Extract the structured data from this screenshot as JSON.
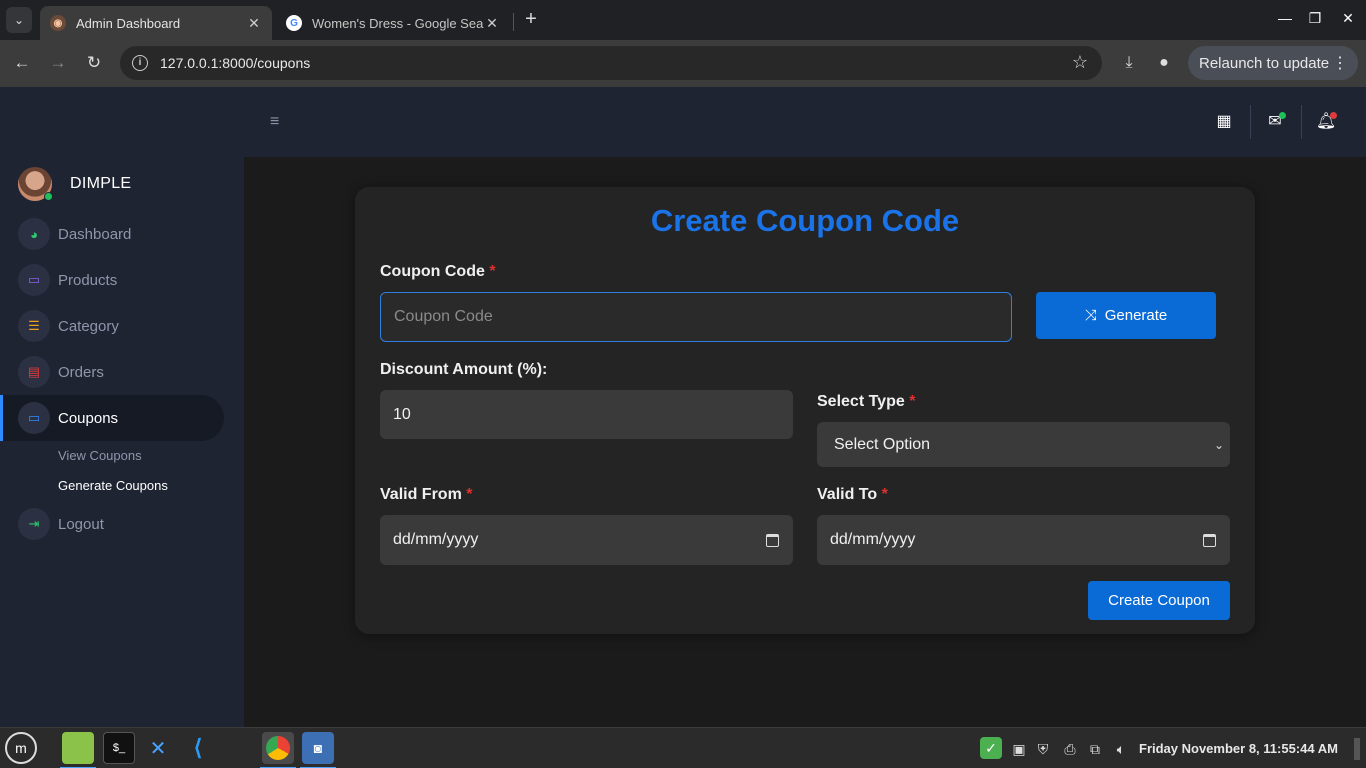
{
  "browser": {
    "tabs": [
      {
        "title": "Admin Dashboard",
        "active": true
      },
      {
        "title": "Women's Dress - Google Sea",
        "active": false
      }
    ],
    "url": "127.0.0.1:8000/coupons",
    "relaunch_label": "Relaunch to update"
  },
  "sidebar": {
    "user_name": "DIMPLE",
    "items": [
      {
        "label": "Dashboard",
        "icon": "gauge-icon",
        "color": "#2ecc71"
      },
      {
        "label": "Products",
        "icon": "laptop-icon",
        "color": "#8e63e8"
      },
      {
        "label": "Category",
        "icon": "list-icon",
        "color": "#f0a020"
      },
      {
        "label": "Orders",
        "icon": "table-icon",
        "color": "#e03b3b"
      },
      {
        "label": "Coupons",
        "icon": "laptop-icon",
        "color": "#2f8cff"
      }
    ],
    "sub_items": [
      {
        "label": "View Coupons"
      },
      {
        "label": "Generate Coupons"
      }
    ],
    "logout_label": "Logout"
  },
  "form": {
    "title": "Create Coupon Code",
    "coupon_code_label": "Coupon Code",
    "coupon_code_placeholder": "Coupon Code",
    "generate_label": "Generate",
    "discount_label": "Discount Amount (%):",
    "discount_value": "10",
    "select_type_label": "Select Type",
    "select_type_value": "Select Option",
    "valid_from_label": "Valid From",
    "valid_from_placeholder": "dd/mm/yyyy",
    "valid_to_label": "Valid To",
    "valid_to_placeholder": "dd/mm/yyyy",
    "required_mark": "*",
    "submit_label": "Create Coupon"
  },
  "taskbar": {
    "clock": "Friday November  8, 11:55:44 AM"
  },
  "colors": {
    "accent": "#1a73e8",
    "required": "#e03131",
    "sidebar_bg": "#1f2433"
  }
}
